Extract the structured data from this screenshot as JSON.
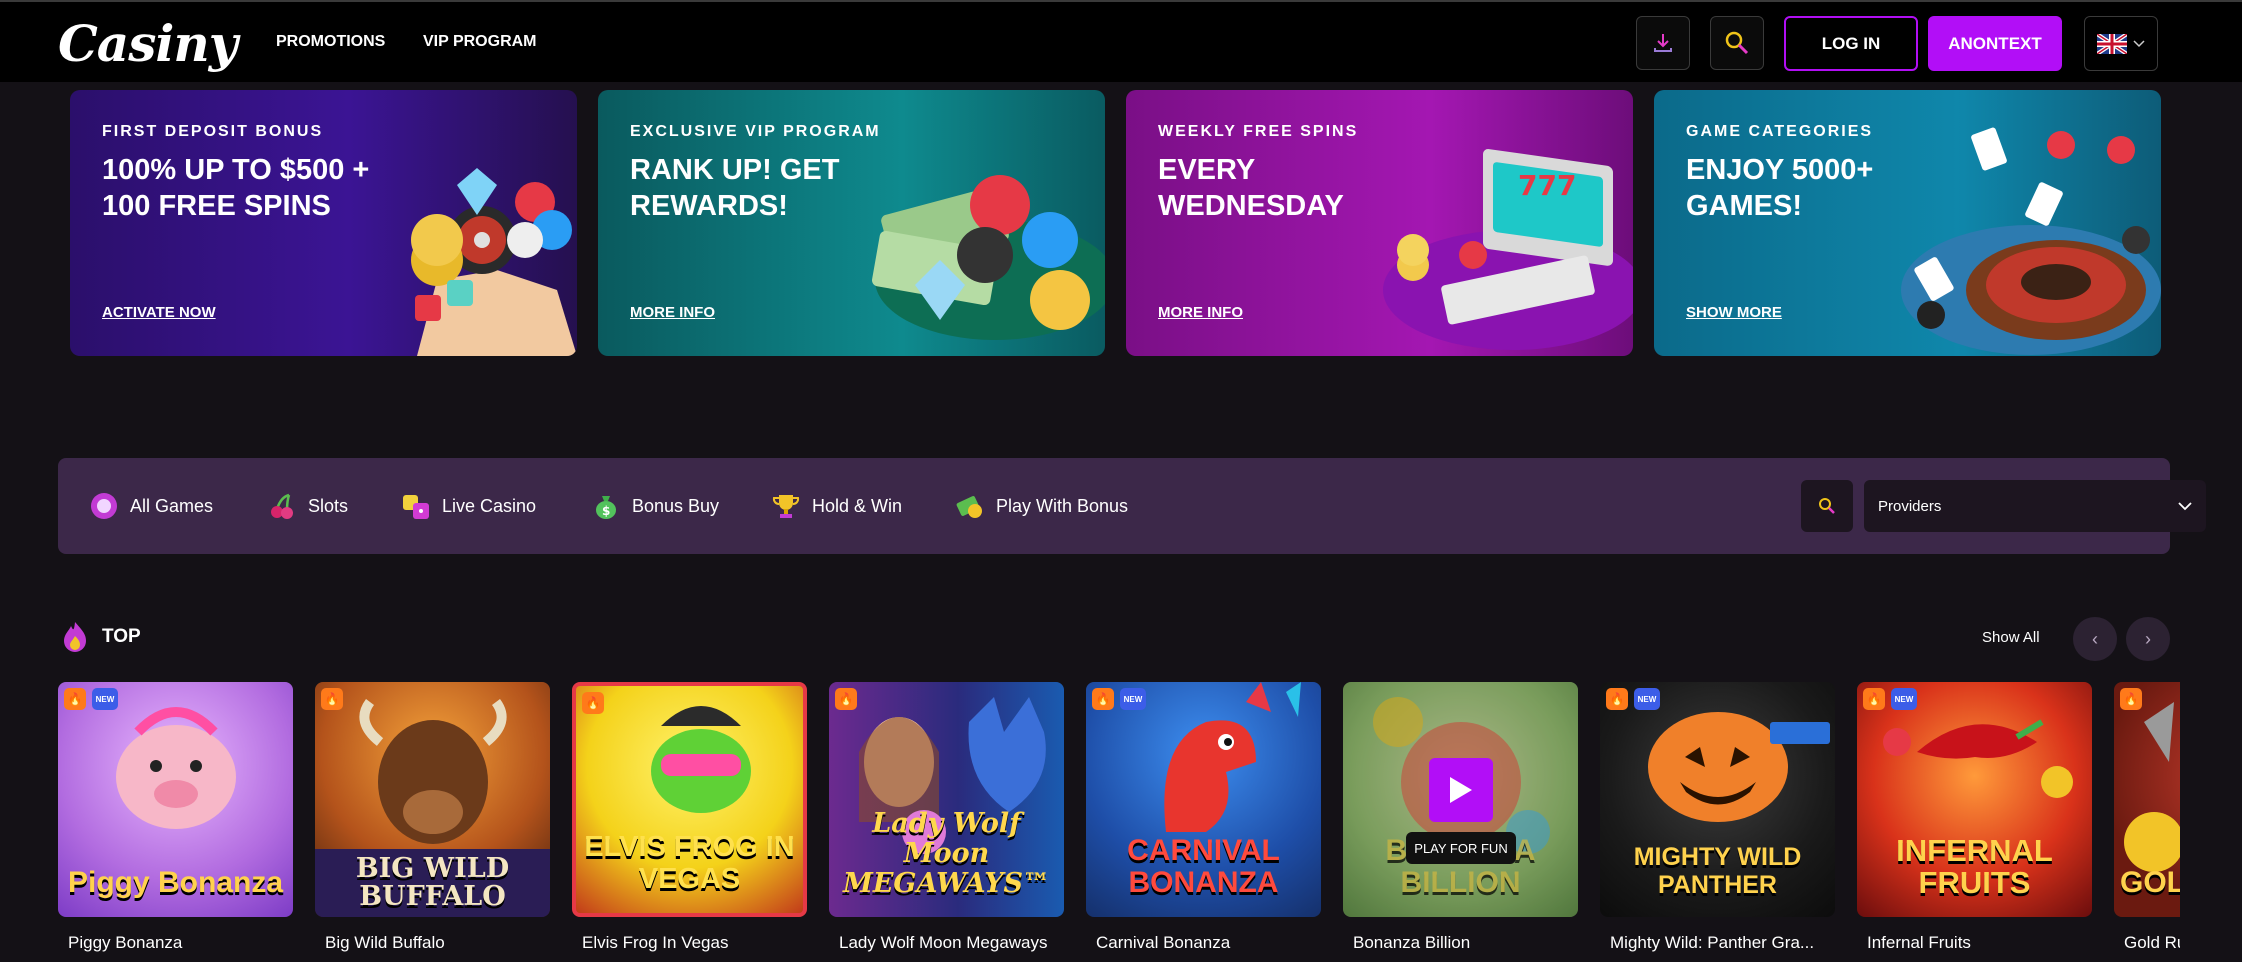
{
  "header": {
    "logo": "Casiny",
    "nav": [
      "PROMOTIONS",
      "VIP PROGRAM"
    ],
    "login": "LOG IN",
    "register": "ANONTEXT"
  },
  "banners": [
    {
      "kicker": "FIRST DEPOSIT BONUS",
      "headline": "100% UP TO $500 + 100 FREE SPINS",
      "cta": "ACTIVATE NOW"
    },
    {
      "kicker": "EXCLUSIVE VIP PROGRAM",
      "headline": "RANK UP! GET REWARDS!",
      "cta": "MORE INFO"
    },
    {
      "kicker": "WEEKLY FREE SPINS",
      "headline": "EVERY WEDNESDAY",
      "cta": "MORE INFO"
    },
    {
      "kicker": "GAME CATEGORIES",
      "headline": "ENJOY 5000+ GAMES!",
      "cta": "SHOW MORE"
    }
  ],
  "categories": [
    "All Games",
    "Slots",
    "Live Casino",
    "Bonus Buy",
    "Hold & Win",
    "Play With Bonus"
  ],
  "providers": {
    "label": "Providers"
  },
  "top": {
    "title": "TOP",
    "show_all": "Show All",
    "prev": "‹",
    "next": "›",
    "play_for_fun": "PLAY FOR FUN"
  },
  "games": [
    {
      "name": "Piggy Bonanza",
      "art": "Piggy Bonanza",
      "new": true
    },
    {
      "name": "Big Wild Buffalo",
      "art": "BIG WILD BUFFALO",
      "new": false
    },
    {
      "name": "Elvis Frog In Vegas",
      "art": "ELVIS FROG IN VEGAS",
      "new": false
    },
    {
      "name": "Lady Wolf Moon Megaways",
      "art": "Lady Wolf Moon MEGAWAYS™",
      "new": false
    },
    {
      "name": "Carnival Bonanza",
      "art": "CARNIVAL BONANZA",
      "new": true
    },
    {
      "name": "Bonanza Billion",
      "art": "BONANZA BILLION",
      "new": false
    },
    {
      "name": "Mighty Wild: Panther Gra...",
      "art": "MIGHTY WILD PANTHER",
      "new": true
    },
    {
      "name": "Infernal Fruits",
      "art": "INFERNAL FRUITS",
      "new": true
    },
    {
      "name": "Gold Ru",
      "art": "GOL",
      "new": false
    }
  ],
  "colors": {
    "accent": "#b20ef7",
    "filter_bar": "#3c2849",
    "background": "#141116"
  }
}
